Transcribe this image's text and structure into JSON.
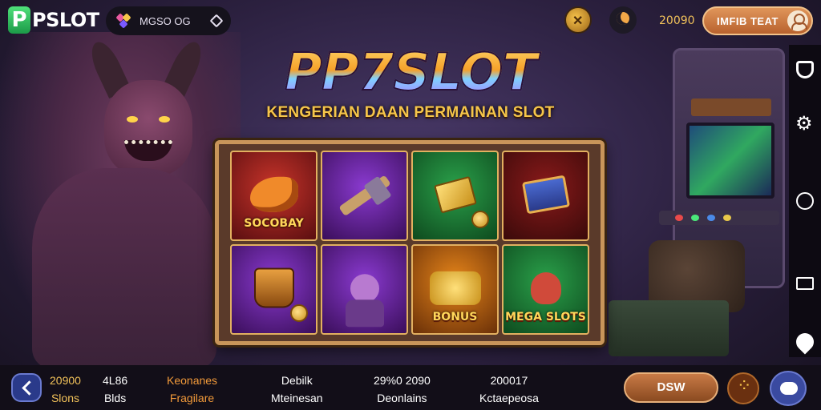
{
  "header": {
    "logo_letter": "P",
    "logo_text": "PSLOT",
    "game_selector_label": "MGSO OG",
    "balance": "20090",
    "profile_label": "IMFIB TEAT"
  },
  "hero": {
    "title": "PP7SLOT",
    "subtitle": "KENGERIAN DAAN PERMAINAN SLOT"
  },
  "slot_tiles": [
    {
      "name": "dragon",
      "label": "SOCOBAY",
      "style": "t-red"
    },
    {
      "name": "hammer",
      "label": "",
      "style": "t-purple"
    },
    {
      "name": "gold-card",
      "label": "",
      "style": "t-green"
    },
    {
      "name": "treasure-chest",
      "label": "",
      "style": "t-crimson"
    },
    {
      "name": "potion-pot",
      "label": "",
      "style": "t-purple"
    },
    {
      "name": "warrior",
      "label": "",
      "style": "t-purple"
    },
    {
      "name": "gold-bonus",
      "label": "BONUS",
      "style": "t-orange"
    },
    {
      "name": "demon",
      "label": "MEGA SLOTS",
      "style": "t-green"
    }
  ],
  "bottom_stats": [
    {
      "value": "20900",
      "label": "Slons",
      "color": "#f2c25a"
    },
    {
      "value": "4L86",
      "label": "Blds",
      "color": "#ffffff"
    },
    {
      "value": "Keonanes",
      "label": "Fragilare",
      "color": "#f29a3a"
    },
    {
      "value": "Debilk",
      "label": "Mteinesan",
      "color": "#ffffff"
    },
    {
      "value": "29%0 2090",
      "label": "Deonlains",
      "color": "#ffffff"
    },
    {
      "value": "200017",
      "label": "Kctaepeosa",
      "color": "#ffffff"
    }
  ],
  "footer": {
    "primary_button": "DSW"
  }
}
